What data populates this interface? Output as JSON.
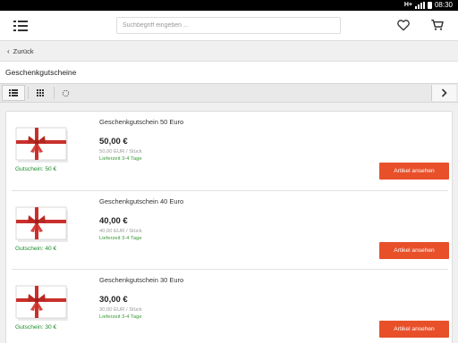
{
  "statusbar": {
    "network": "H+",
    "time": "08:30"
  },
  "header": {
    "search_placeholder": "Suchbegriff eingeben ..."
  },
  "backlink": {
    "label": "Zurück"
  },
  "page": {
    "title": "Geschenkgutscheine"
  },
  "products": [
    {
      "name": "Geschenkgutschein 50 Euro",
      "thumb_label": "Gutschein: 50 €",
      "price": "50,00 €",
      "unit_price": "50,00 EUR / Stück",
      "delivery": "Lieferzeit 3-4 Tage",
      "button": "Artikel ansehen"
    },
    {
      "name": "Geschenkgutschein 40 Euro",
      "thumb_label": "Gutschein: 40 €",
      "price": "40,00 €",
      "unit_price": "40,00 EUR / Stück",
      "delivery": "Lieferzeit 3-4 Tage",
      "button": "Artikel ansehen"
    },
    {
      "name": "Geschenkgutschein 30 Euro",
      "thumb_label": "Gutschein: 30 €",
      "price": "30,00 €",
      "unit_price": "30,00 EUR / Stück",
      "delivery": "Lieferzeit 3-4 Tage",
      "button": "Artikel ansehen"
    }
  ],
  "colors": {
    "accent": "#e8502a",
    "delivery_green": "#3a9a3a",
    "ribbon": "#c9302c"
  },
  "icons": {
    "menu": "hamburger-icon",
    "wishlist": "heart-icon",
    "cart": "cart-icon",
    "back": "chevron-left-icon",
    "list_view": "list-view-icon",
    "grid_view": "grid-view-icon",
    "loading": "spinner-icon",
    "next": "chevron-right-icon"
  }
}
